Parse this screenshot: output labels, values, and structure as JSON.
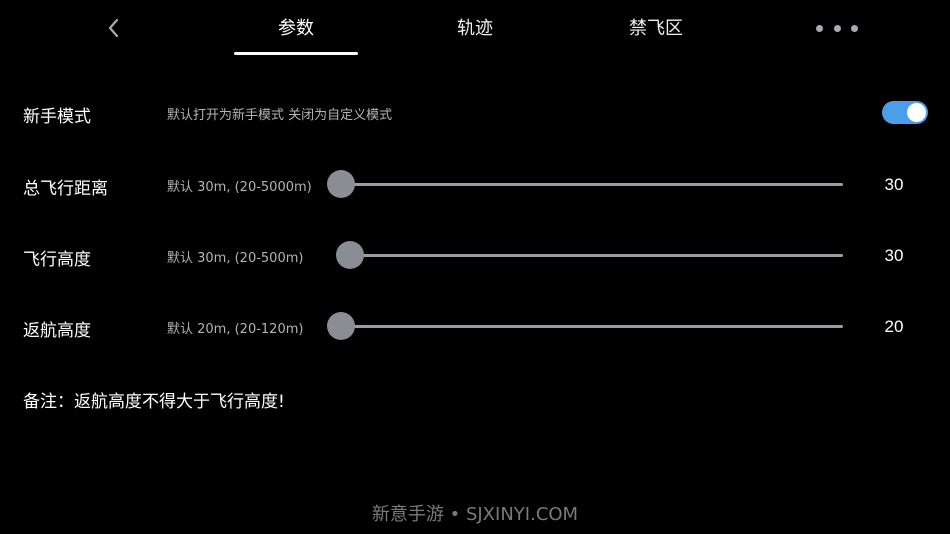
{
  "header": {
    "tabs": [
      {
        "label": "参数",
        "active": true
      },
      {
        "label": "轨迹",
        "active": false
      },
      {
        "label": "禁飞区",
        "active": false
      }
    ],
    "back_icon": "chevron-left-icon",
    "more_icon": "more-horizontal-icon"
  },
  "settings": {
    "novice_mode": {
      "label": "新手模式",
      "hint": "默认打开为新手模式 关闭为自定义模式",
      "enabled": true
    },
    "sliders": [
      {
        "label": "总飞行距离",
        "hint": "默认 30m, (20-5000m)",
        "value": "30",
        "min": 20,
        "max": 5000
      },
      {
        "label": "飞行高度",
        "hint": "默认 30m, (20-500m)",
        "value": "30",
        "min": 20,
        "max": 500
      },
      {
        "label": "返航高度",
        "hint": "默认 20m, (20-120m)",
        "value": "20",
        "min": 20,
        "max": 120
      }
    ]
  },
  "note": "备注：返航高度不得大于飞行高度!",
  "watermark": "新意手游 • SJXINYI.COM",
  "colors": {
    "background": "#000000",
    "accent": "#4a9eea",
    "slider_thumb": "#8a8d94",
    "slider_track": "#9a9ca2"
  }
}
